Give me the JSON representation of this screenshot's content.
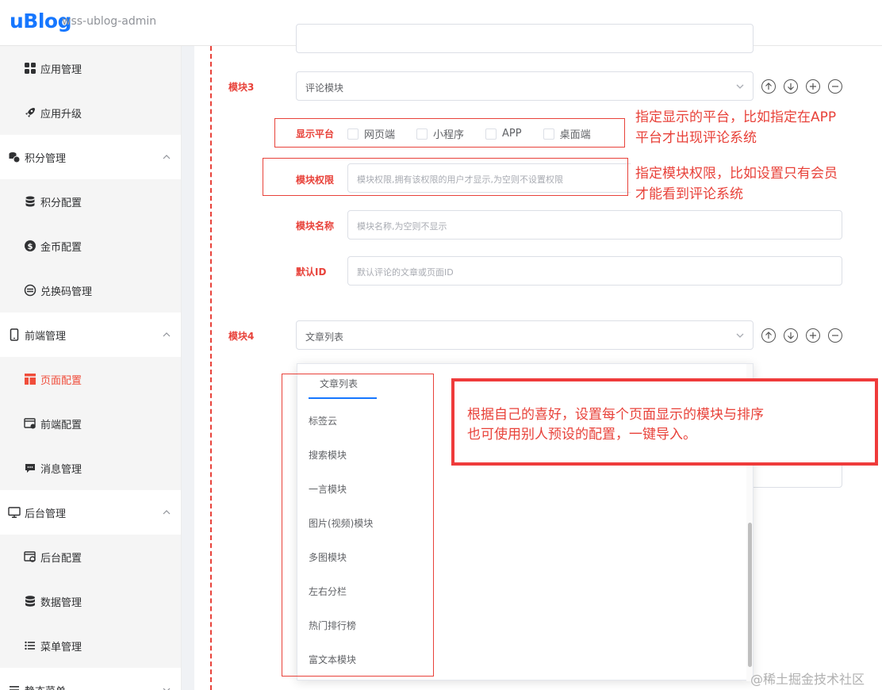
{
  "header": {
    "logo": "uBlog",
    "site_name": "wss-ublog-admin"
  },
  "sidebar": {
    "items": [
      {
        "label": "应用管理",
        "icon": "grid-icon",
        "type": "sub"
      },
      {
        "label": "应用升级",
        "icon": "rocket-icon",
        "type": "sub"
      },
      {
        "label": "积分管理",
        "icon": "coins-icon",
        "type": "group",
        "expanded": true
      },
      {
        "label": "积分配置",
        "icon": "database-icon",
        "type": "sub"
      },
      {
        "label": "金币配置",
        "icon": "dollar-icon",
        "type": "sub"
      },
      {
        "label": "兑换码管理",
        "icon": "exchange-icon",
        "type": "sub"
      },
      {
        "label": "前端管理",
        "icon": "phone-icon",
        "type": "group",
        "expanded": true
      },
      {
        "label": "页面配置",
        "icon": "layout-icon",
        "type": "sub",
        "active": true
      },
      {
        "label": "前端配置",
        "icon": "browser-settings-icon",
        "type": "sub"
      },
      {
        "label": "消息管理",
        "icon": "message-icon",
        "type": "sub"
      },
      {
        "label": "后台管理",
        "icon": "monitor-icon",
        "type": "group",
        "expanded": true
      },
      {
        "label": "后台配置",
        "icon": "admin-settings-icon",
        "type": "sub"
      },
      {
        "label": "数据管理",
        "icon": "database-icon",
        "type": "sub"
      },
      {
        "label": "菜单管理",
        "icon": "list-icon",
        "type": "sub"
      },
      {
        "label": "静态菜单",
        "icon": "menu-icon",
        "type": "group"
      }
    ]
  },
  "form": {
    "module3": {
      "label": "模块3",
      "value": "评论模块",
      "platform_label": "显示平台",
      "platforms": [
        "网页端",
        "小程序",
        "APP",
        "桌面端"
      ],
      "permission_label": "模块权限",
      "permission_placeholder": "模块权限,拥有该权限的用户才显示,为空则不设置权限",
      "name_label": "模块名称",
      "name_placeholder": "模块名称,为空则不显示",
      "default_id_label": "默认ID",
      "default_id_placeholder": "默认评论的文章或页面ID"
    },
    "module4": {
      "label": "模块4",
      "value": "文章列表"
    }
  },
  "dropdown": {
    "options": [
      "文章列表",
      "标签云",
      "搜索模块",
      "一言模块",
      "图片(视频)模块",
      "多图模块",
      "左右分栏",
      "热门排行榜",
      "富文本模块"
    ],
    "selected": "文章列表"
  },
  "annotations": {
    "platform_note_1": "指定显示的平台，比如指定在APP",
    "platform_note_2": "平台才出现评论系统",
    "permission_note_1": "指定模块权限，比如设置只有会员",
    "permission_note_2": "才能看到评论系统",
    "big_note_1": "根据自己的喜好，设置每个页面显示的模块与排序",
    "big_note_2": "也可使用别人预设的配置，一键导入。"
  },
  "watermark": "@稀土掘金技术社区",
  "colors": {
    "accent_red": "#e8423a",
    "brand_blue": "#1677ff",
    "active_menu": "#f04d3b"
  }
}
